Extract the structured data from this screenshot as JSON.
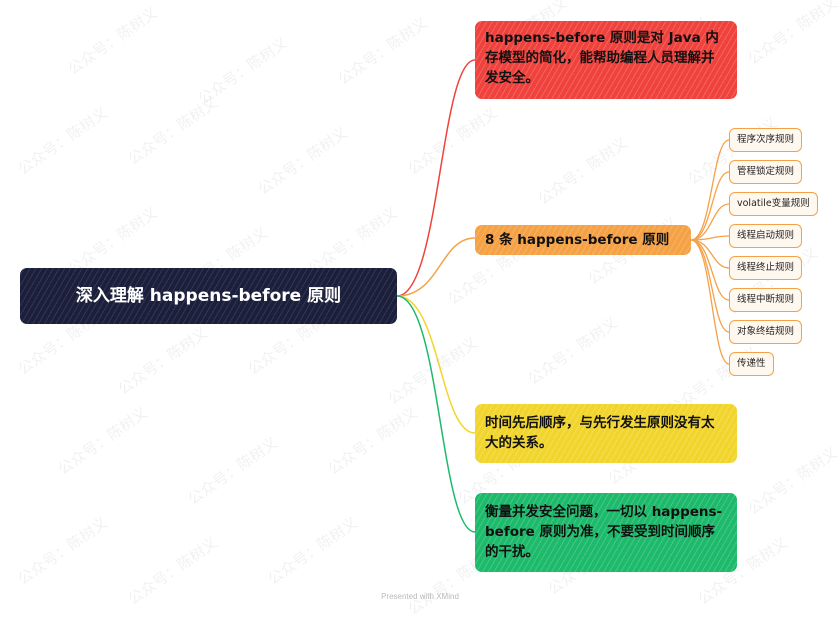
{
  "root": {
    "label": "深入理解 happens-before 原则",
    "color": "#1b1f3b"
  },
  "branches": [
    {
      "label": "happens-before 原则是对 Java 内存模型的简化，能帮助编程人员理解并发安全。",
      "color": "#f0423d"
    },
    {
      "label": "8 条 happens-before 原则",
      "color": "#f5a146"
    },
    {
      "label": "时间先后顺序，与先行发生原则没有太大的关系。",
      "color": "#f2d52c"
    },
    {
      "label": "衡量并发安全问题，一切以 happens-before 原则为准，不要受到时间顺序的干扰。",
      "color": "#1dba6c"
    }
  ],
  "rules": [
    "程序次序规则",
    "管程锁定规则",
    "volatile变量规则",
    "线程启动规则",
    "线程终止规则",
    "线程中断规则",
    "对象终结规则",
    "传递性"
  ],
  "watermark": "公众号：陈树义",
  "footer": "Presented with XMind"
}
